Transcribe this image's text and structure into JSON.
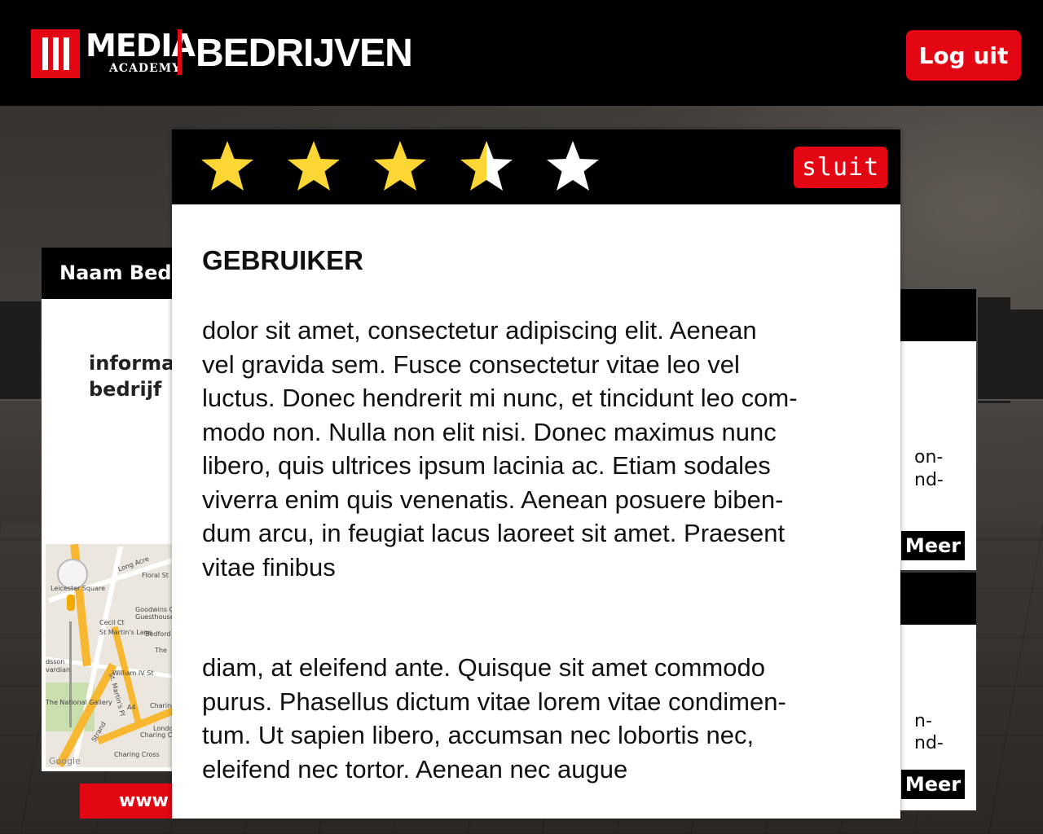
{
  "header": {
    "logo_main": "MEDIA",
    "logo_sub": "ACADEMY",
    "title": "BEDRIJVEN",
    "logout_label": "Log uit"
  },
  "company_card": {
    "name": "Naam Bed",
    "info_line1": "informa",
    "info_line2": "bedrijf",
    "url": "www"
  },
  "map": {
    "labels": [
      "Long Acre",
      "Floral St",
      "Leicester Square",
      "Goodwins Cou",
      "Guesthouse",
      "Cecil Ct",
      "St Martin's Lane",
      "Bedford",
      "The",
      "William IV St",
      "St. Martin's Pl",
      "A4",
      "Charing",
      "London",
      "Charing Cros",
      "The National Gallery",
      "Strand",
      "Charing Cross",
      "Google",
      "dsson",
      "vardian"
    ]
  },
  "side_cards": [
    {
      "text_line1": "on-",
      "text_line2": "nd-",
      "more_label": "Meer"
    },
    {
      "text_line1": "n-",
      "text_line2": "nd-",
      "more_label": "Meer"
    }
  ],
  "rating": {
    "value": 3.5,
    "max": 5,
    "filled_color": "#fcd634",
    "empty_color": "#ffffff"
  },
  "modal": {
    "close_label": "sluit",
    "user": "GEBRUIKER",
    "paragraph1": " dolor sit amet, consectetur adipiscing elit. Aenean\nvel gravida sem. Fusce consectetur vitae leo vel\nluctus. Donec hendrerit mi nunc, et tincidunt leo com-\nmodo non. Nulla non elit nisi. Donec maximus nunc\nlibero, quis ultrices ipsum lacinia ac. Etiam sodales\nviverra enim quis venenatis. Aenean posuere biben-\ndum arcu, in feugiat lacus laoreet sit amet. Praesent\nvitae finibus",
    "paragraph2": "diam, at eleifend ante. Quisque sit amet commodo\npurus. Phasellus dictum vitae lorem vitae condimen-\ntum. Ut sapien libero, accumsan nec lobortis nec,\neleifend nec tortor. Aenean nec augue"
  },
  "colors": {
    "brand_red": "#e30613",
    "header_bg": "#000000"
  }
}
